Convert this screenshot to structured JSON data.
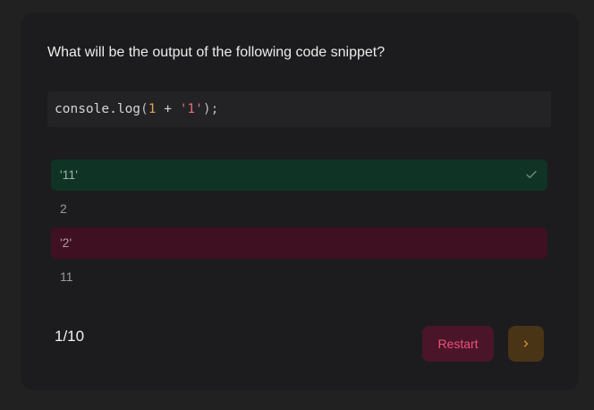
{
  "quiz": {
    "question": "What will be the output of the following code snippet?",
    "code": {
      "fn": "console.log",
      "open": "(",
      "num": "1",
      "op": " + ",
      "str": "'1'",
      "close": ");"
    },
    "options": [
      {
        "label": "'11'",
        "state": "correct"
      },
      {
        "label": "2",
        "state": "neutral"
      },
      {
        "label": "'2'",
        "state": "wrong"
      },
      {
        "label": "11",
        "state": "neutral"
      }
    ],
    "progress": "1/10",
    "restart_label": "Restart"
  },
  "icons": {
    "check": "check-icon",
    "next": "chevron-right-icon"
  },
  "colors": {
    "background": "#212121",
    "card": "#1c1c1e",
    "correct": "#0f3324",
    "wrong": "#3e1021",
    "restart_bg": "#4a1529",
    "restart_text": "#f0517a",
    "next_bg": "#4a3416",
    "next_icon": "#e0a040"
  }
}
